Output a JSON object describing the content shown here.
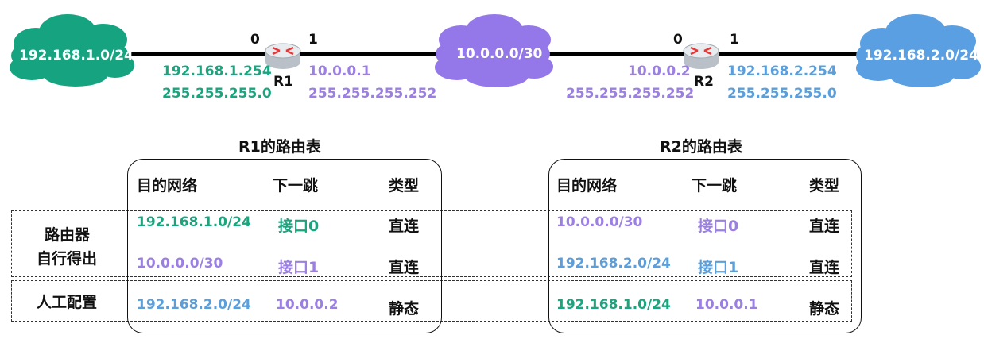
{
  "colors": {
    "green": "#1aa57f",
    "purple": "#9b7fe2",
    "blue": "#5a9fdc",
    "cloud_green": "#16a37f",
    "cloud_purple": "#9477e8",
    "cloud_blue": "#5a9fe2"
  },
  "topology": {
    "net1": "192.168.1.0/24",
    "net2": "10.0.0.0/30",
    "net3": "192.168.2.0/24",
    "r1": {
      "name": "R1",
      "port0": "0",
      "port1": "1",
      "if0_ip": "192.168.1.254",
      "if0_mask": "255.255.255.0",
      "if1_ip": "10.0.0.1",
      "if1_mask": "255.255.255.252"
    },
    "r2": {
      "name": "R2",
      "port0": "0",
      "port1": "1",
      "if0_ip": "10.0.0.2",
      "if0_mask": "255.255.255.252",
      "if1_ip": "192.168.2.254",
      "if1_mask": "255.255.255.0"
    }
  },
  "row_labels": {
    "auto_line1": "路由器",
    "auto_line2": "自行得出",
    "manual": "人工配置"
  },
  "r1_table": {
    "title": "R1的路由表",
    "headers": [
      "目的网络",
      "下一跳",
      "类型"
    ],
    "rows": [
      [
        "192.168.1.0/24",
        "接口0",
        "直连"
      ],
      [
        "10.0.0.0/30",
        "接口1",
        "直连"
      ],
      [
        "192.168.2.0/24",
        "10.0.0.2",
        "静态"
      ]
    ]
  },
  "r2_table": {
    "title": "R2的路由表",
    "headers": [
      "目的网络",
      "下一跳",
      "类型"
    ],
    "rows": [
      [
        "10.0.0.0/30",
        "接口0",
        "直连"
      ],
      [
        "192.168.2.0/24",
        "接口1",
        "直连"
      ],
      [
        "192.168.1.0/24",
        "10.0.0.1",
        "静态"
      ]
    ]
  }
}
